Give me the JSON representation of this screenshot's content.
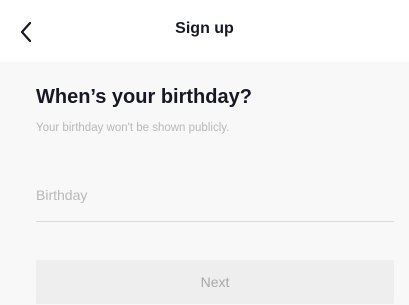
{
  "header": {
    "back_icon": "chevron-left-icon",
    "title": "Sign up"
  },
  "main": {
    "heading": "When’s your birthday?",
    "subtext": "Your birthday won't be shown publicly.",
    "birthday_field": {
      "placeholder": "Birthday",
      "value": ""
    },
    "next_button": {
      "label": "Next",
      "enabled": false
    }
  },
  "colors": {
    "text_primary": "#161823",
    "text_muted": "#b8b8bb",
    "content_background": "#f8f8f8",
    "button_disabled_bg": "#eeeeef",
    "button_disabled_text": "#a8a8ab"
  }
}
